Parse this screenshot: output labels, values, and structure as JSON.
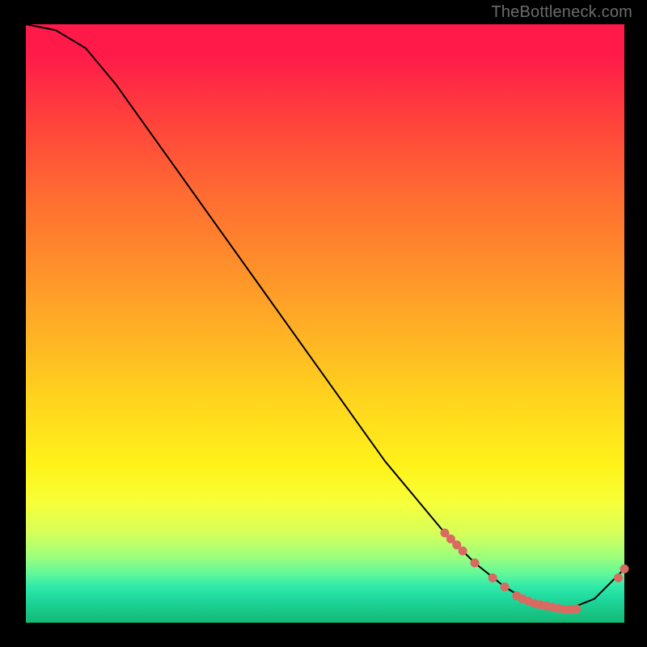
{
  "watermark": "TheBottleneck.com",
  "chart_data": {
    "type": "line",
    "title": "",
    "xlabel": "",
    "ylabel": "",
    "xlim": [
      0,
      100
    ],
    "ylim": [
      0,
      100
    ],
    "grid": false,
    "legend": false,
    "series": [
      {
        "name": "bottleneck-curve",
        "x": [
          0,
          5,
          10,
          15,
          20,
          25,
          30,
          35,
          40,
          45,
          50,
          55,
          60,
          65,
          70,
          75,
          80,
          85,
          90,
          95,
          100
        ],
        "values": [
          100,
          99,
          96,
          90,
          83,
          76,
          69,
          62,
          55,
          48,
          41,
          34,
          27,
          21,
          15,
          10,
          6,
          3,
          2,
          4,
          9
        ]
      }
    ],
    "highlight_points": {
      "name": "highlighted-range",
      "x": [
        70,
        71,
        72,
        73,
        75,
        78,
        80,
        82,
        83,
        84,
        85,
        86,
        87,
        88,
        89,
        90,
        91,
        92,
        99,
        100
      ],
      "values": [
        15,
        14,
        13,
        12,
        10,
        7.5,
        6,
        4.5,
        4,
        3.6,
        3.2,
        3,
        2.8,
        2.6,
        2.4,
        2.2,
        2.2,
        2.3,
        7.5,
        9
      ]
    },
    "background_gradient": {
      "direction": "vertical-top-to-bottom",
      "stops": [
        {
          "pos": 0.0,
          "color": "#ff1a4a"
        },
        {
          "pos": 0.28,
          "color": "#ff6a32"
        },
        {
          "pos": 0.62,
          "color": "#ffd21e"
        },
        {
          "pos": 0.8,
          "color": "#f7ff3a"
        },
        {
          "pos": 0.92,
          "color": "#5cf79b"
        },
        {
          "pos": 1.0,
          "color": "#14b876"
        }
      ]
    }
  }
}
